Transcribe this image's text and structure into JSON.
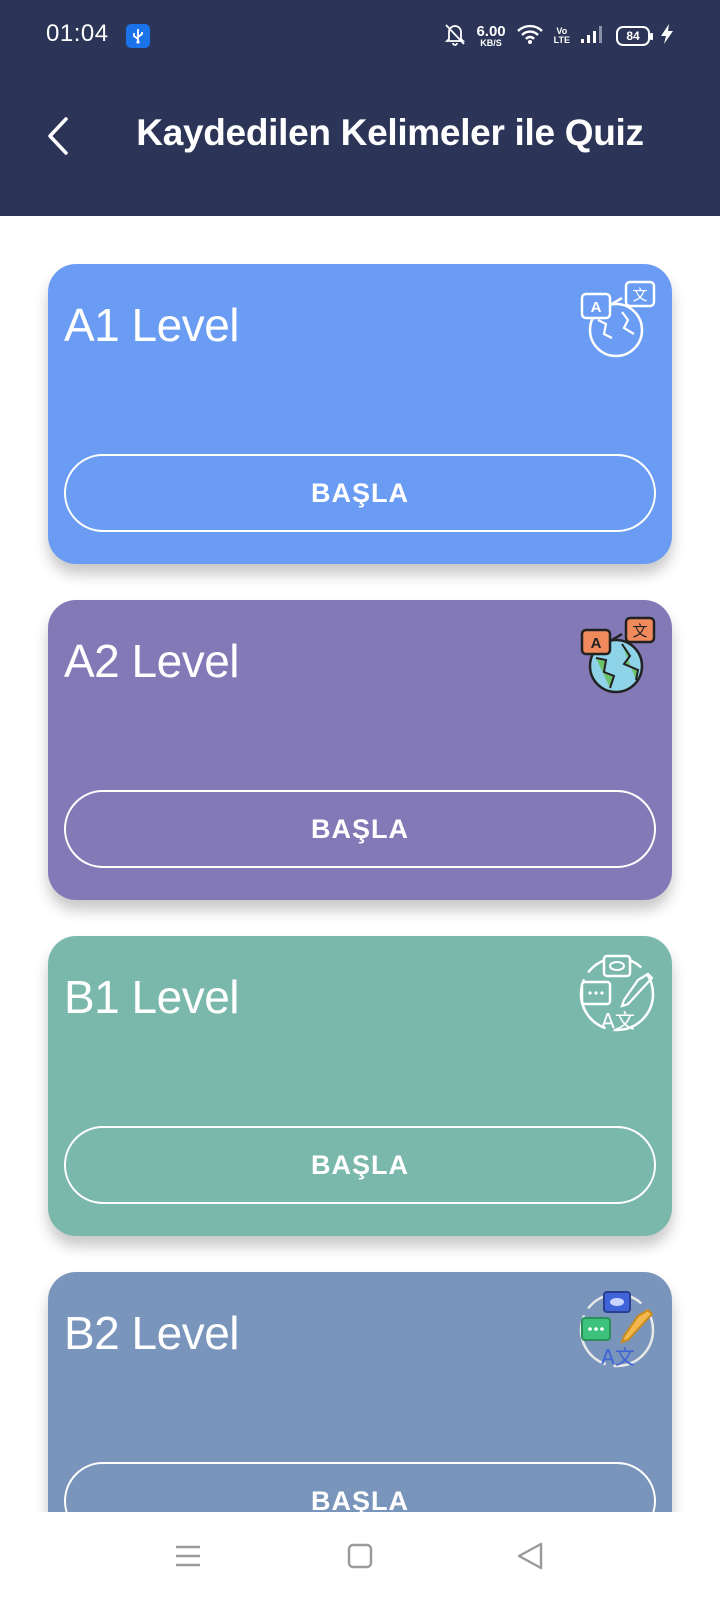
{
  "status_bar": {
    "time": "01:04",
    "net_speed_value": "6.00",
    "net_speed_unit": "KB/S",
    "volte_top": "Vo",
    "volte_bottom": "LTE",
    "battery": "84"
  },
  "header": {
    "title": "Kaydedilen Kelimeler ile Quiz",
    "background": "#2c3557"
  },
  "levels": [
    {
      "label": "A1 Level",
      "button": "BAŞLA",
      "color": "#6a9cf3",
      "icon": "translation-globe-outline-icon"
    },
    {
      "label": "A2 Level",
      "button": "BAŞLA",
      "color": "#8479b7",
      "icon": "translation-globe-color-icon"
    },
    {
      "label": "B1 Level",
      "button": "BAŞLA",
      "color": "#7bb8ac",
      "icon": "language-chat-outline-icon"
    },
    {
      "label": "B2 Level",
      "button": "BAŞLA",
      "color": "#7a95bb",
      "icon": "language-chat-color-icon"
    }
  ],
  "nav": {
    "items": [
      "menu-icon",
      "home-icon",
      "back-icon"
    ]
  }
}
